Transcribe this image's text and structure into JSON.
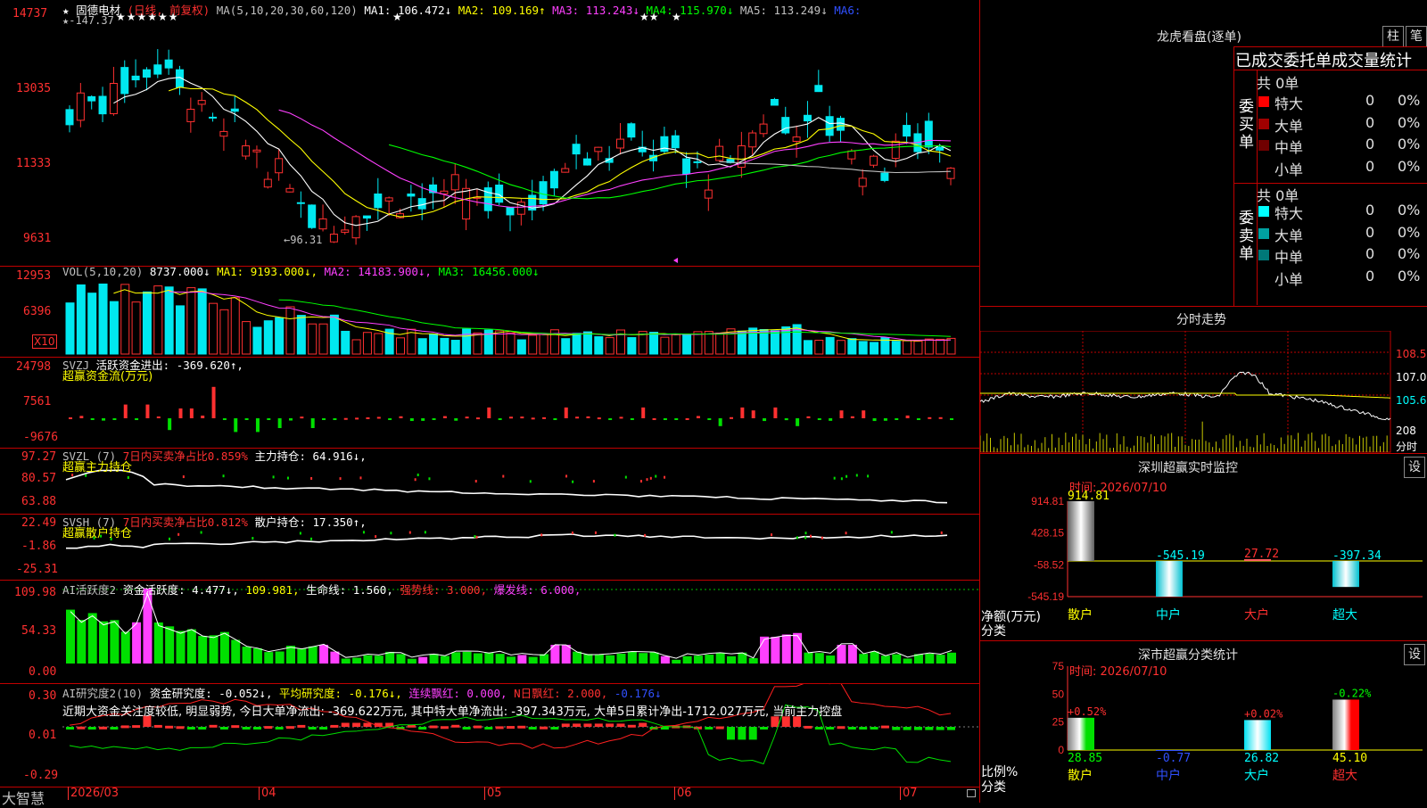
{
  "app_name": "大智慧",
  "colors": {
    "up": "#ff3030",
    "down": "#00e8f0",
    "grid_red": "#c00000"
  },
  "kline": {
    "title_star": "★",
    "stock_name": "固德电材",
    "period": "(日线, 前复权)",
    "ma_label": "MA(5,10,20,30,60,120)",
    "ma": {
      "0": {
        "label": "MA1:",
        "value": "106.472↓"
      },
      "1": {
        "label": "MA2:",
        "value": "109.169↑"
      },
      "2": {
        "label": "MA3:",
        "value": "113.243↓"
      },
      "3": {
        "label": "MA4:",
        "value": "115.970↓"
      },
      "4": {
        "label": "MA5:",
        "value": "113.249↓"
      },
      "5": {
        "label": "MA6:",
        "value": ""
      }
    },
    "y_ticks": {
      "0": "14737",
      "1": "13035",
      "2": "11333",
      "3": "9631"
    },
    "high_mark": "147.37",
    "low_mark": "96.31",
    "marker_stars": {
      "0": "★★★★★★",
      "1": "★",
      "2": "★★",
      "3": "★"
    }
  },
  "vol": {
    "title": "VOL(5,10,20)",
    "value": "8737.000↓",
    "ma": {
      "0": "MA1: 9193.000↓,",
      "1": "MA2: 14183.900↓,",
      "2": "MA3: 16456.000↓"
    },
    "y_ticks": {
      "0": "12953",
      "1": "6396"
    },
    "unit": "X10"
  },
  "svzj": {
    "title": "SVZJ",
    "label": "活跃资金进出:",
    "value": "-369.620↑,",
    "subtitle": "超赢资金流(万元)",
    "y_ticks": {
      "0": "24798",
      "1": "7561",
      "2": "-9676"
    }
  },
  "svzl": {
    "title": "SVZL (7)",
    "label": "7日内买卖净占比0.859%",
    "label2": "主力持仓:",
    "value": "64.916↓,",
    "subtitle": "超赢主力持仓",
    "y_ticks": {
      "0": "97.27",
      "1": "80.57",
      "2": "63.88"
    }
  },
  "svsh": {
    "title": "SVSH (7)",
    "label": "7日内买卖净占比0.812%",
    "label2": "散户持仓:",
    "value": "17.350↑,",
    "subtitle": "超赢散户持仓",
    "y_ticks": {
      "0": "22.49",
      "1": "-1.86",
      "2": "-25.31"
    }
  },
  "ai_huoyue": {
    "title": "AI活跃度2",
    "label": "资金活跃度:",
    "value": "4.477↓,",
    "value2": "109.981,",
    "life_label": "生命线:",
    "life_value": "1.560,",
    "strong": "强势线: 3.000,",
    "burst": "爆发线: 6.000,",
    "y_ticks": {
      "0": "109.98",
      "1": "54.33",
      "2": "0.00"
    }
  },
  "ai_yanjiu": {
    "title": "AI研究度2(10)",
    "label": "资金研究度:",
    "value": "-0.052↓,",
    "avg": "平均研究度: -0.176↓,",
    "lianxu": "连续飘红: 0.000,",
    "n_red": "N日飘红: 2.000,",
    "last": "-0.176↓",
    "comment": "近期大资金关注度较低, 明显弱势, 今日大单净流出: -369.622万元, 其中特大单净流出: -397.343万元, 大单5日累计净出-1712.027万元, 当前主力控盘",
    "y_ticks": {
      "0": "0.30",
      "1": "0.01",
      "2": "-0.29"
    }
  },
  "x_axis": {
    "0": "2026/03",
    "1": "04",
    "2": "05",
    "3": "06",
    "4": "07"
  },
  "longhu": {
    "title": "龙虎看盘(逐单)",
    "btn_bar": "柱",
    "btn_pen": "笔",
    "heading": "已成交委托单成交量统计",
    "buy": {
      "side": "委\n买\n单",
      "total": "共 0单",
      "rows": {
        "0": {
          "name": "特大",
          "count": "0",
          "pct": "0%",
          "color": "#ff0000"
        },
        "1": {
          "name": "大单",
          "count": "0",
          "pct": "0%",
          "color": "#a00000"
        },
        "2": {
          "name": "中单",
          "count": "0",
          "pct": "0%",
          "color": "#700000"
        },
        "3": {
          "name": "小单",
          "count": "0",
          "pct": "0%",
          "color": ""
        }
      }
    },
    "sell": {
      "side": "委\n卖\n单",
      "total": "共 0单",
      "rows": {
        "0": {
          "name": "特大",
          "count": "0",
          "pct": "0%",
          "color": "#00ffff"
        },
        "1": {
          "name": "大单",
          "count": "0",
          "pct": "0%",
          "color": "#00a0a0"
        },
        "2": {
          "name": "中单",
          "count": "0",
          "pct": "0%",
          "color": "#007878"
        },
        "3": {
          "name": "小单",
          "count": "0",
          "pct": "0%",
          "color": ""
        }
      }
    }
  },
  "fenshi": {
    "title": "分时走势",
    "y_ticks": {
      "0": "108.5",
      "1": "107.0",
      "2": "105.6"
    },
    "vol_label": "208",
    "unit": "分时"
  },
  "sz_monitor": {
    "title": "深圳超赢实时监控",
    "btn": "设",
    "time": "时间: 2026/07/10",
    "y_ticks": {
      "0": "914.81",
      "1": "428.15",
      "2": "-58.52",
      "3": "-545.19"
    },
    "ylabel": "净额(万元)",
    "xlabel": "分类",
    "bars": {
      "0": {
        "cat": "散户",
        "value": 914.81,
        "label": "914.81"
      },
      "1": {
        "cat": "中户",
        "value": -545.19,
        "label": "-545.19"
      },
      "2": {
        "cat": "大户",
        "value": 27.72,
        "label": "27.72"
      },
      "3": {
        "cat": "超大",
        "value": -397.34,
        "label": "-397.34"
      }
    }
  },
  "sz_stats": {
    "title": "深市超赢分类统计",
    "btn": "设",
    "time": "时间: 2026/07/10",
    "y_ticks": {
      "0": "75",
      "1": "50",
      "2": "25",
      "3": "0"
    },
    "ylabel": "比例%",
    "xlabel": "分类",
    "bars": {
      "0": {
        "cat": "散户",
        "value": 28.85,
        "label": "28.85",
        "change": "+0.52%"
      },
      "1": {
        "cat": "中户",
        "value": -0.77,
        "label": "-0.77",
        "change": ""
      },
      "2": {
        "cat": "大户",
        "value": 26.82,
        "label": "26.82",
        "change": "+0.02%"
      },
      "3": {
        "cat": "超大",
        "value": 45.1,
        "label": "45.10",
        "change": "-0.22%"
      }
    }
  },
  "chart_data": [
    {
      "type": "bar",
      "title": "深圳超赢实时监控",
      "categories": [
        "散户",
        "中户",
        "大户",
        "超大"
      ],
      "values": [
        914.81,
        -545.19,
        27.72,
        -397.34
      ],
      "ylabel": "净额(万元)",
      "xlabel": "分类",
      "ylim": [
        -545.19,
        914.81
      ]
    },
    {
      "type": "bar",
      "title": "深市超赢分类统计",
      "categories": [
        "散户",
        "中户",
        "大户",
        "超大"
      ],
      "values": [
        28.85,
        -0.77,
        26.82,
        45.1
      ],
      "ylabel": "比例%",
      "xlabel": "分类",
      "ylim": [
        0,
        75
      ]
    }
  ]
}
